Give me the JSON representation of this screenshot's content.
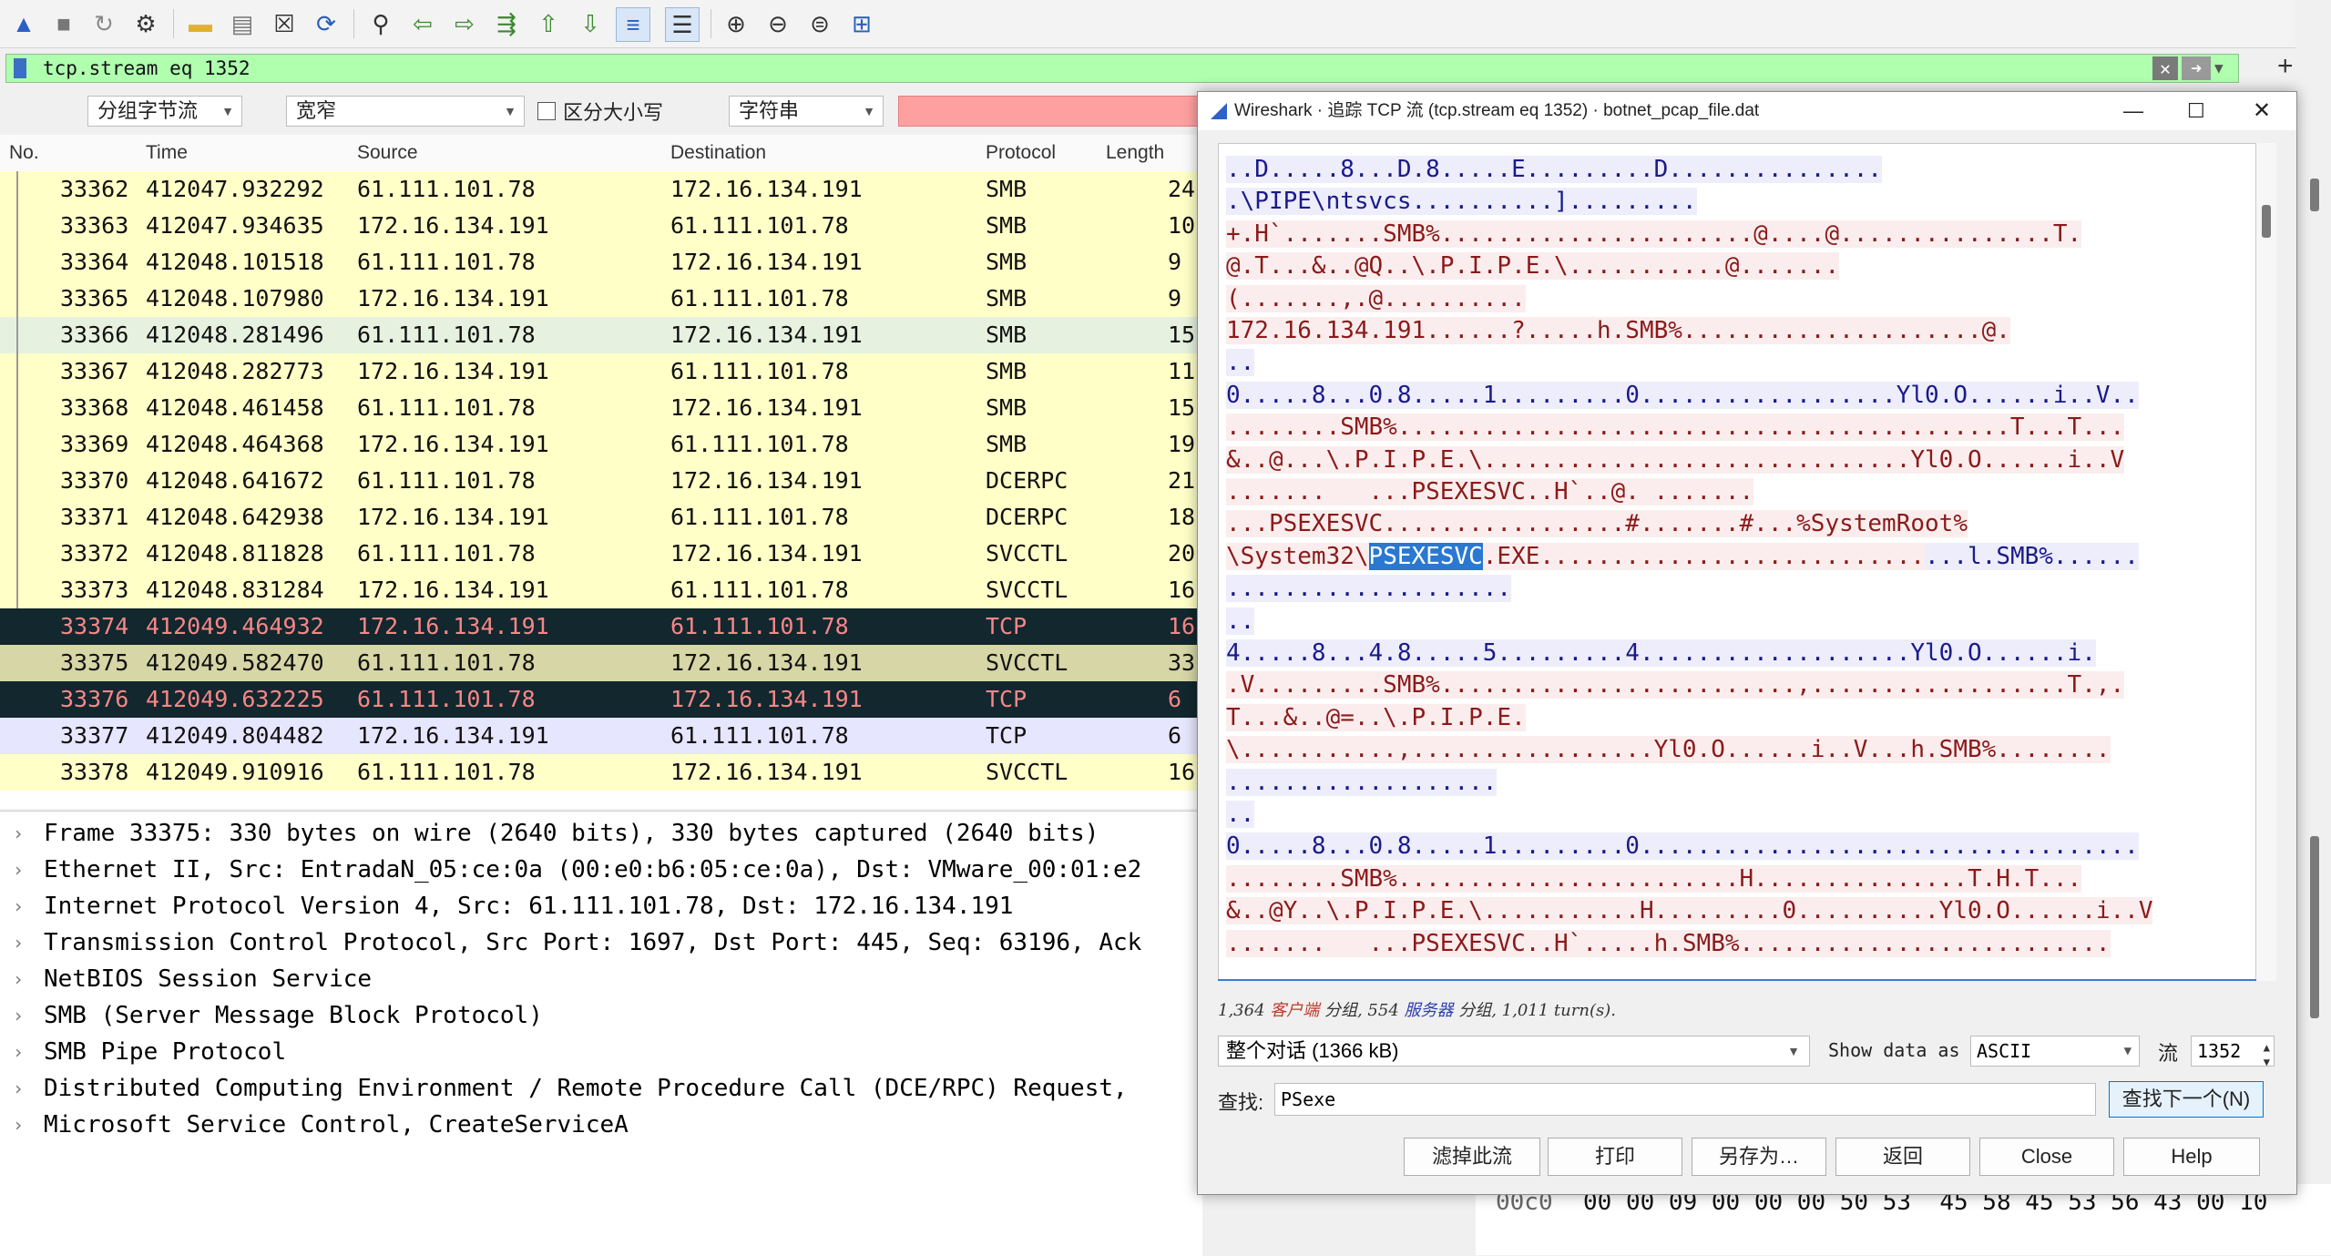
{
  "toolbar": {
    "icons": [
      "shark-fin-start-icon",
      "stop-icon",
      "restart-icon",
      "options-gear-icon",
      "open-folder-icon",
      "save-file-icon",
      "close-file-icon",
      "reload-icon",
      "find-icon",
      "go-back-icon",
      "go-forward-icon",
      "go-to-packet-icon",
      "first-packet-icon",
      "last-packet-icon",
      "autoscroll-icon",
      "colorize-icon",
      "zoom-in-icon",
      "zoom-out-icon",
      "zoom-reset-icon",
      "resize-columns-icon"
    ]
  },
  "filter": {
    "value": "tcp.stream eq 1352",
    "plus": "+"
  },
  "search": {
    "scope": "分组字节流",
    "charset": "宽窄",
    "case_label": "区分大小写",
    "type": "字符串"
  },
  "packet_list": {
    "columns": [
      "No.",
      "Time",
      "Source",
      "Destination",
      "Protocol",
      "Length"
    ],
    "rows": [
      {
        "no": "33362",
        "time": "412047.932292",
        "src": "61.111.101.78",
        "dst": "172.16.134.191",
        "proto": "SMB",
        "len": "24"
      },
      {
        "no": "33363",
        "time": "412047.934635",
        "src": "172.16.134.191",
        "dst": "61.111.101.78",
        "proto": "SMB",
        "len": "10"
      },
      {
        "no": "33364",
        "time": "412048.101518",
        "src": "61.111.101.78",
        "dst": "172.16.134.191",
        "proto": "SMB",
        "len": "9"
      },
      {
        "no": "33365",
        "time": "412048.107980",
        "src": "172.16.134.191",
        "dst": "61.111.101.78",
        "proto": "SMB",
        "len": "9"
      },
      {
        "no": "33366",
        "time": "412048.281496",
        "src": "61.111.101.78",
        "dst": "172.16.134.191",
        "proto": "SMB",
        "len": "15"
      },
      {
        "no": "33367",
        "time": "412048.282773",
        "src": "172.16.134.191",
        "dst": "61.111.101.78",
        "proto": "SMB",
        "len": "11"
      },
      {
        "no": "33368",
        "time": "412048.461458",
        "src": "61.111.101.78",
        "dst": "172.16.134.191",
        "proto": "SMB",
        "len": "15"
      },
      {
        "no": "33369",
        "time": "412048.464368",
        "src": "172.16.134.191",
        "dst": "61.111.101.78",
        "proto": "SMB",
        "len": "19"
      },
      {
        "no": "33370",
        "time": "412048.641672",
        "src": "61.111.101.78",
        "dst": "172.16.134.191",
        "proto": "DCERPC",
        "len": "21"
      },
      {
        "no": "33371",
        "time": "412048.642938",
        "src": "172.16.134.191",
        "dst": "61.111.101.78",
        "proto": "DCERPC",
        "len": "18"
      },
      {
        "no": "33372",
        "time": "412048.811828",
        "src": "61.111.101.78",
        "dst": "172.16.134.191",
        "proto": "SVCCTL",
        "len": "20"
      },
      {
        "no": "33373",
        "time": "412048.831284",
        "src": "172.16.134.191",
        "dst": "61.111.101.78",
        "proto": "SVCCTL",
        "len": "16"
      },
      {
        "no": "33374",
        "time": "412049.464932",
        "src": "172.16.134.191",
        "dst": "61.111.101.78",
        "proto": "TCP",
        "len": "16"
      },
      {
        "no": "33375",
        "time": "412049.582470",
        "src": "61.111.101.78",
        "dst": "172.16.134.191",
        "proto": "SVCCTL",
        "len": "33"
      },
      {
        "no": "33376",
        "time": "412049.632225",
        "src": "61.111.101.78",
        "dst": "172.16.134.191",
        "proto": "TCP",
        "len": "6"
      },
      {
        "no": "33377",
        "time": "412049.804482",
        "src": "172.16.134.191",
        "dst": "61.111.101.78",
        "proto": "TCP",
        "len": "6"
      },
      {
        "no": "33378",
        "time": "412049.910916",
        "src": "61.111.101.78",
        "dst": "172.16.134.191",
        "proto": "SVCCTL",
        "len": "16"
      }
    ],
    "colors": {
      "smb": "#ffffc8",
      "selected": "#d6d6a6",
      "dark": "#12272e",
      "dark_text": "#f78787",
      "tcp": "#e7e6ff",
      "hover": "#e6f2df"
    }
  },
  "details": [
    "Frame 33375: 330 bytes on wire (2640 bits), 330 bytes captured (2640 bits)",
    "Ethernet II, Src: EntradaN_05:ce:0a (00:e0:b6:05:ce:0a), Dst: VMware_00:01:e2",
    "Internet Protocol Version 4, Src: 61.111.101.78, Dst: 172.16.134.191",
    "Transmission Control Protocol, Src Port: 1697, Dst Port: 445, Seq: 63196, Ack",
    "NetBIOS Session Service",
    "SMB (Server Message Block Protocol)",
    "SMB Pipe Protocol",
    "Distributed Computing Environment / Remote Procedure Call (DCE/RPC) Request,",
    "Microsoft Service Control, CreateServiceA"
  ],
  "hex": {
    "offset": "00c0",
    "bytes": "00 00 09 00 00 00 50 53  45 58 45 53 56 43 00 10"
  },
  "dialog": {
    "title": "Wireshark · 追踪 TCP 流 (tcp.stream eq 1352) · botnet_pcap_file.dat",
    "stream_lines": [
      {
        "cls": "srv",
        "text": "..D.....8...D.8.....E.........D..............."
      },
      {
        "cls": "srv",
        "text": ".\\PIPE\\ntsvcs..........]........."
      },
      {
        "cls": "cli",
        "text": "+.H`.......SMB%......................@....@...............T."
      },
      {
        "cls": "cli",
        "text": "@.T...&..@Q..\\.P.I.P.E.\\...........@......."
      },
      {
        "cls": "cli",
        "text": "(.......,.@.........."
      },
      {
        "cls": "cli",
        "text": "172.16.134.191......?.....h.SMB%.....................@."
      },
      {
        "cls": "srv",
        "text": ".."
      },
      {
        "cls": "srv",
        "text": "0.....8...0.8.....1.........0..................Yl0.O......i..V.."
      },
      {
        "cls": "cli",
        "text": "........SMB%...........................................T...T..."
      },
      {
        "cls": "cli",
        "text": "&..@...\\.P.I.P.E.\\..............................Yl0.O......i..V"
      },
      {
        "cls": "cli",
        "text": ".......   ...PSEXESVC..H`..@. ......."
      },
      {
        "cls": "cli",
        "text": "...PSEXESVC.................#.......#...%SystemRoot%"
      },
      {
        "cls": "cli",
        "text": "\\System32\\",
        "hl": "PSEXESVC",
        "after": ".EXE...........................",
        "tail": "...l.SMB%......"
      },
      {
        "cls": "srv",
        "text": "...................."
      },
      {
        "cls": "srv",
        "text": ".."
      },
      {
        "cls": "srv",
        "text": "4.....8...4.8.....5.........4...................Yl0.O......i."
      },
      {
        "cls": "cli",
        "text": ".V.........SMB%.........................,..................T.,."
      },
      {
        "cls": "cli",
        "text": "T...&..@=..\\.P.I.P.E."
      },
      {
        "cls": "cli",
        "text": "\\...........,.................Yl0.O......i..V...h.SMB%........"
      },
      {
        "cls": "srv",
        "text": "..................."
      },
      {
        "cls": "srv",
        "text": ".."
      },
      {
        "cls": "srv",
        "text": "0.....8...0.8.....1.........0..................................."
      },
      {
        "cls": "cli",
        "text": "........SMB%........................H...............T.H.T..."
      },
      {
        "cls": "cli",
        "text": "&..@Y..\\.P.I.P.E.\\...........H.........0..........Yl0.O......i..V"
      },
      {
        "cls": "cli",
        "text": ".......   ...PSEXESVC..H`.....h.SMB%.........................."
      }
    ],
    "summary_pre": "1,364 ",
    "summary_client": "客户端",
    "summary_mid": " 分组, 554 ",
    "summary_server": "服务器",
    "summary_post": " 分组, 1,011 turn(s).",
    "conversation": "整个对话 (1366 kB)",
    "show_as_label": "Show data as",
    "show_as_value": "ASCII",
    "stream_label": "流",
    "stream_value": "1352",
    "find_label": "查找:",
    "find_value": "PSexe",
    "find_next": "查找下一个(N)",
    "buttons": [
      "滤掉此流",
      "打印",
      "另存为…",
      "返回",
      "Close",
      "Help"
    ]
  }
}
